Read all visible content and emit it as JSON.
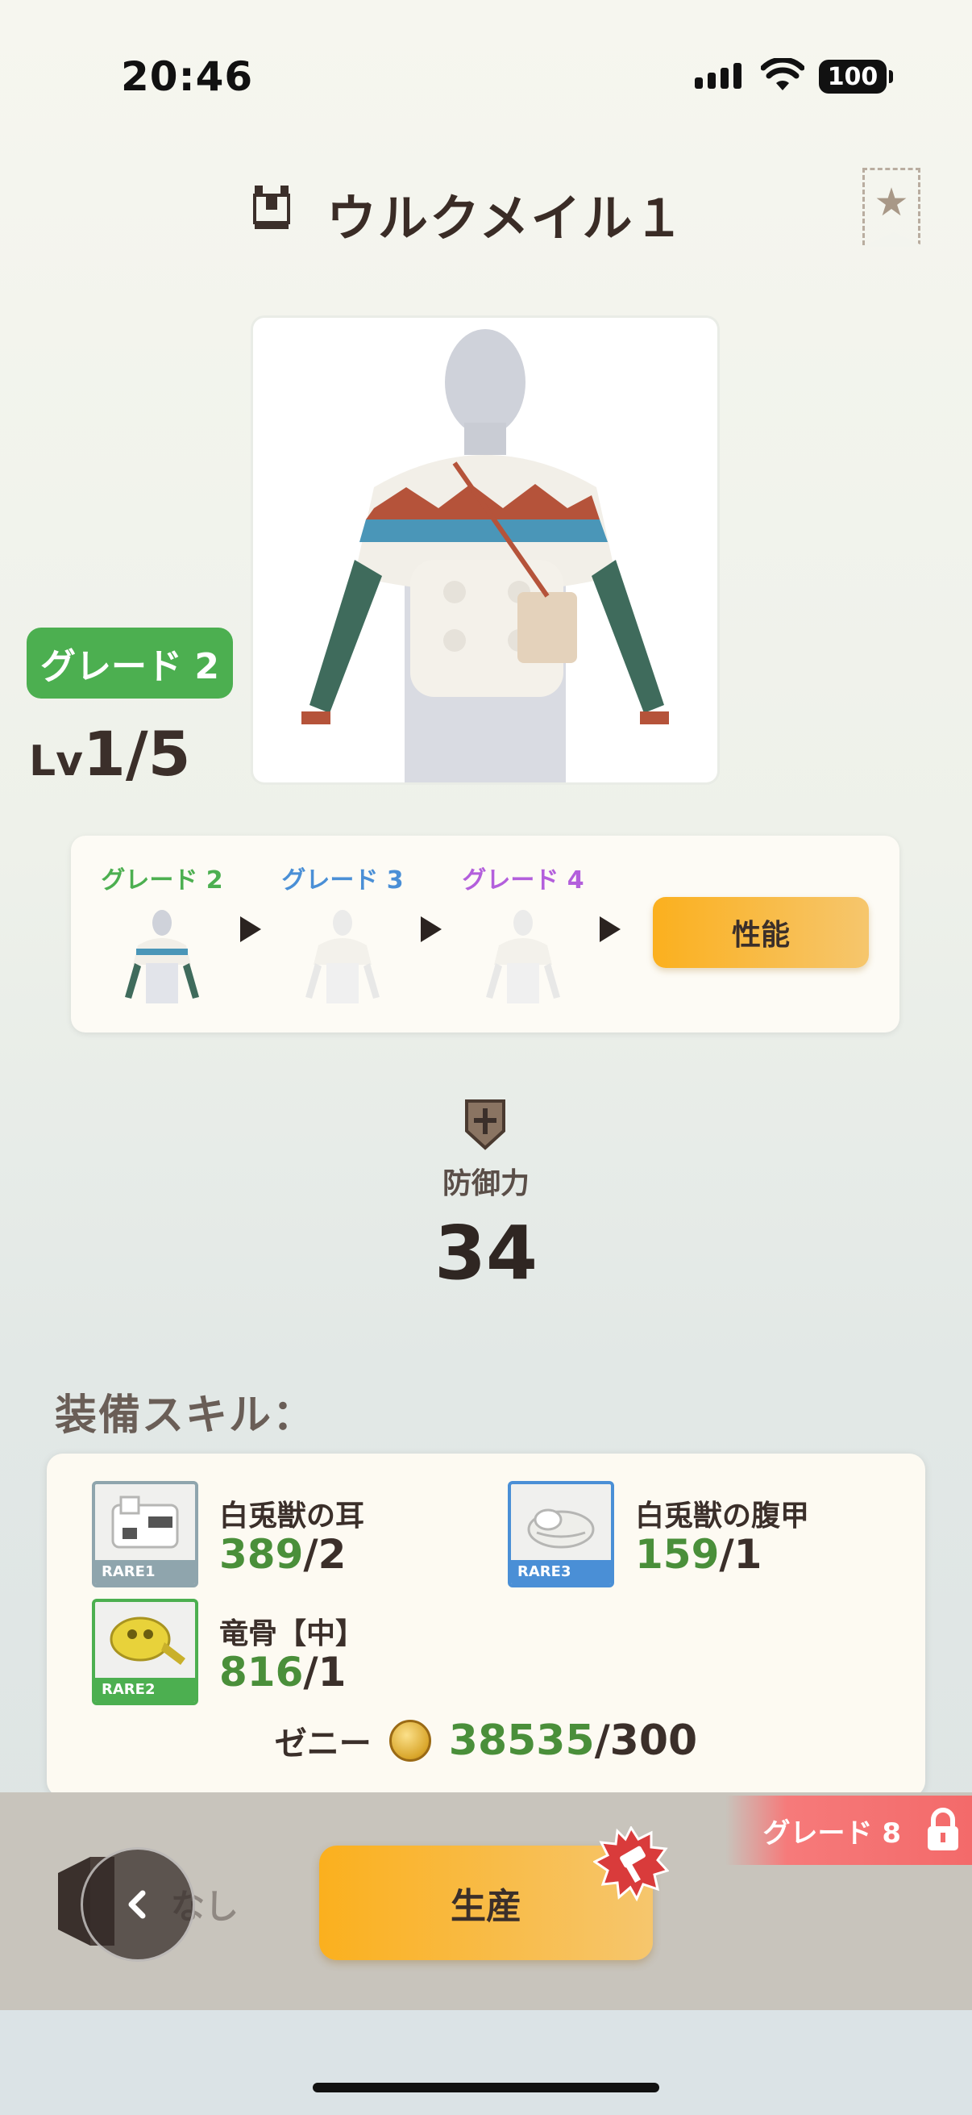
{
  "status": {
    "time": "20:46",
    "battery": "100"
  },
  "header": {
    "title": "ウルクメイル１",
    "favorite_icon": "star-icon"
  },
  "item": {
    "grade_badge": "グレード 2",
    "level_prefix": "Lv",
    "level_value": "1/5"
  },
  "grades": [
    {
      "label": "グレード 2",
      "color": "#4caf50"
    },
    {
      "label": "グレード 3",
      "color": "#4a8fd6"
    },
    {
      "label": "グレード 4",
      "color": "#b35fdc"
    }
  ],
  "performance_button": "性能",
  "defense": {
    "label": "防御力",
    "value": "34"
  },
  "skills_label": "装備スキル：",
  "materials": [
    {
      "name": "白兎獣の耳",
      "have": "389",
      "need": "/2",
      "rarity": "RARE1",
      "rarity_color": "#8fa5ad"
    },
    {
      "name": "白兎獣の腹甲",
      "have": "159",
      "need": "/1",
      "rarity": "RARE3",
      "rarity_color": "#4a8fd6"
    },
    {
      "name": "竜骨【中】",
      "have": "816",
      "need": "/1",
      "rarity": "RARE2",
      "rarity_color": "#4caf50"
    }
  ],
  "zeny": {
    "label": "ゼニー",
    "have": "38535",
    "need": "/300"
  },
  "bottom": {
    "grade_lock": "グレード 8",
    "none_label": "なし",
    "produce_button": "生産"
  }
}
